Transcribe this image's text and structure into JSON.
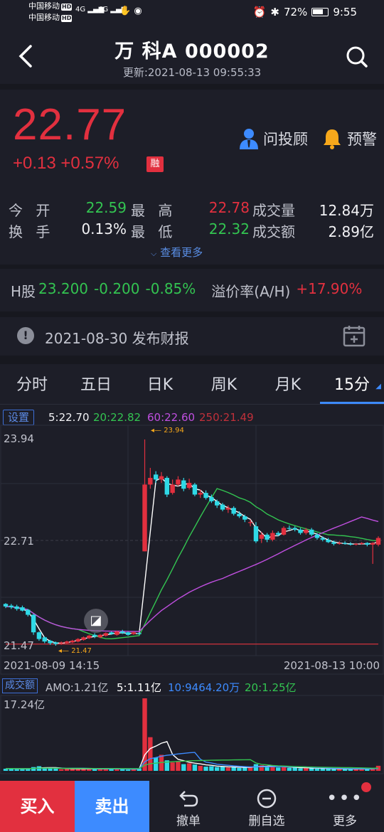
{
  "status_bar": {
    "carrier1": "中国移动",
    "carrier2": "中国移动",
    "hd": "HD",
    "signal1": "4G",
    "signal2": "4G",
    "battery": "72%",
    "time": "9:55"
  },
  "header": {
    "title": "万  科A 000002",
    "updated": "更新:2021-08-13 09:55:33"
  },
  "quote": {
    "price": "22.77",
    "change": "+0.13  +0.57%",
    "margin_badge": "融",
    "advisor_label": "问投顾",
    "alert_label": "预警"
  },
  "stats": {
    "open_label": "今 开",
    "open": "22.59",
    "high_label": "最 高",
    "high": "22.78",
    "volume_label": "成交量",
    "volume": "12.84万",
    "turnover_label": "换 手",
    "turnover": "0.13%",
    "low_label": "最 低",
    "low": "22.32",
    "amount_label": "成交额",
    "amount": "2.89亿",
    "more": "查看更多"
  },
  "h_share": {
    "label": "H股",
    "price": "23.200",
    "change": "-0.200",
    "pct": "-0.85%",
    "premium_label": "溢价率(A/H)",
    "premium": "+17.90%"
  },
  "report": {
    "text": "2021-08-30 发布财报"
  },
  "tabs": [
    "分时",
    "五日",
    "日K",
    "周K",
    "月K",
    "15分"
  ],
  "chart_legend": {
    "settings": "设置",
    "ma5": "5:22.70",
    "ma20": "20:22.82",
    "ma60": "60:22.60",
    "ma250": "250:21.49",
    "y_high": "23.94",
    "y_mid": "22.71",
    "y_low": "21.47",
    "mark_high": "23.94",
    "mark_low": "21.47",
    "date_start": "2021-08-09 14:15",
    "date_end": "2021-08-13 10:00"
  },
  "volume_legend": {
    "label": "成交额",
    "amo": "AMO:1.21亿",
    "ma5": "5:1.11亿",
    "ma10": "10:9464.20万",
    "ma20": "20:1.25亿",
    "max": "17.24亿"
  },
  "colors": {
    "up": "#e2303f",
    "down": "#2fd9e6",
    "ma5": "#ffffff",
    "ma20": "#33c451",
    "ma60": "#c04fe0",
    "ma250": "#c0303a",
    "accent": "#3d8bff"
  },
  "bottom_bar": {
    "buy": "买入",
    "sell": "卖出",
    "cancel": "撤单",
    "remove_watch": "删自选",
    "more": "更多"
  },
  "chart_data": {
    "type": "candlestick",
    "ylim": [
      21.47,
      23.94
    ],
    "candles": [
      {
        "o": 21.97,
        "c": 21.94,
        "h": 21.98,
        "l": 21.92
      },
      {
        "o": 21.95,
        "c": 21.93,
        "h": 21.97,
        "l": 21.91
      },
      {
        "o": 21.94,
        "c": 21.91,
        "h": 21.96,
        "l": 21.89
      },
      {
        "o": 21.93,
        "c": 21.89,
        "h": 21.95,
        "l": 21.88
      },
      {
        "o": 21.9,
        "c": 21.84,
        "h": 21.91,
        "l": 21.82
      },
      {
        "o": 21.84,
        "c": 21.63,
        "h": 21.85,
        "l": 21.6
      },
      {
        "o": 21.63,
        "c": 21.55,
        "h": 21.64,
        "l": 21.53
      },
      {
        "o": 21.57,
        "c": 21.52,
        "h": 21.58,
        "l": 21.5
      },
      {
        "o": 21.53,
        "c": 21.5,
        "h": 21.54,
        "l": 21.48
      },
      {
        "o": 21.51,
        "c": 21.49,
        "h": 21.52,
        "l": 21.47
      },
      {
        "o": 21.5,
        "c": 21.51,
        "h": 21.52,
        "l": 21.48
      },
      {
        "o": 21.5,
        "c": 21.52,
        "h": 21.53,
        "l": 21.49
      },
      {
        "o": 21.51,
        "c": 21.53,
        "h": 21.54,
        "l": 21.5
      },
      {
        "o": 21.52,
        "c": 21.55,
        "h": 21.56,
        "l": 21.51
      },
      {
        "o": 21.54,
        "c": 21.57,
        "h": 21.58,
        "l": 21.53
      },
      {
        "o": 21.56,
        "c": 21.59,
        "h": 21.6,
        "l": 21.55
      },
      {
        "o": 21.6,
        "c": 21.58,
        "h": 21.62,
        "l": 21.56
      },
      {
        "o": 21.57,
        "c": 21.6,
        "h": 21.61,
        "l": 21.56
      },
      {
        "o": 21.59,
        "c": 21.62,
        "h": 21.63,
        "l": 21.58
      },
      {
        "o": 21.63,
        "c": 21.61,
        "h": 21.64,
        "l": 21.6
      },
      {
        "o": 21.6,
        "c": 21.64,
        "h": 21.65,
        "l": 21.59
      },
      {
        "o": 21.64,
        "c": 21.62,
        "h": 21.66,
        "l": 21.61
      },
      {
        "o": 21.63,
        "c": 21.6,
        "h": 21.64,
        "l": 21.59
      },
      {
        "o": 21.61,
        "c": 21.63,
        "h": 21.64,
        "l": 21.6
      },
      {
        "o": 21.62,
        "c": 21.61,
        "h": 21.63,
        "l": 21.6
      },
      {
        "o": 22.6,
        "c": 23.4,
        "h": 23.94,
        "l": 22.6
      },
      {
        "o": 23.4,
        "c": 23.48,
        "h": 23.6,
        "l": 23.35
      },
      {
        "o": 23.52,
        "c": 23.46,
        "h": 23.56,
        "l": 23.42
      },
      {
        "o": 23.46,
        "c": 23.5,
        "h": 23.55,
        "l": 23.42
      },
      {
        "o": 23.48,
        "c": 23.28,
        "h": 23.5,
        "l": 23.25
      },
      {
        "o": 23.3,
        "c": 23.4,
        "h": 23.46,
        "l": 23.28
      },
      {
        "o": 23.4,
        "c": 23.46,
        "h": 23.5,
        "l": 23.38
      },
      {
        "o": 23.45,
        "c": 23.35,
        "h": 23.48,
        "l": 23.32
      },
      {
        "o": 23.36,
        "c": 23.42,
        "h": 23.47,
        "l": 23.34
      },
      {
        "o": 23.4,
        "c": 23.28,
        "h": 23.42,
        "l": 23.26
      },
      {
        "o": 23.28,
        "c": 23.3,
        "h": 23.34,
        "l": 23.24
      },
      {
        "o": 23.3,
        "c": 23.24,
        "h": 23.33,
        "l": 23.22
      },
      {
        "o": 23.25,
        "c": 23.2,
        "h": 23.28,
        "l": 23.18
      },
      {
        "o": 23.2,
        "c": 23.15,
        "h": 23.22,
        "l": 23.12
      },
      {
        "o": 23.16,
        "c": 23.1,
        "h": 23.18,
        "l": 23.08
      },
      {
        "o": 23.1,
        "c": 23.12,
        "h": 23.15,
        "l": 23.06
      },
      {
        "o": 23.12,
        "c": 23.05,
        "h": 23.14,
        "l": 23.03
      },
      {
        "o": 23.05,
        "c": 23.02,
        "h": 23.08,
        "l": 23.0
      },
      {
        "o": 23.02,
        "c": 22.98,
        "h": 23.04,
        "l": 22.95
      },
      {
        "o": 22.95,
        "c": 22.95,
        "h": 22.98,
        "l": 22.9
      },
      {
        "o": 22.9,
        "c": 22.72,
        "h": 22.95,
        "l": 22.7
      },
      {
        "o": 22.75,
        "c": 22.8,
        "h": 22.83,
        "l": 22.7
      },
      {
        "o": 22.8,
        "c": 22.74,
        "h": 22.82,
        "l": 22.71
      },
      {
        "o": 22.74,
        "c": 22.82,
        "h": 22.85,
        "l": 22.72
      },
      {
        "o": 22.82,
        "c": 22.8,
        "h": 22.84,
        "l": 22.78
      },
      {
        "o": 22.8,
        "c": 22.88,
        "h": 22.9,
        "l": 22.79
      },
      {
        "o": 22.88,
        "c": 22.87,
        "h": 22.91,
        "l": 22.85
      },
      {
        "o": 22.88,
        "c": 22.86,
        "h": 22.9,
        "l": 22.84
      },
      {
        "o": 22.86,
        "c": 22.82,
        "h": 22.88,
        "l": 22.8
      },
      {
        "o": 22.82,
        "c": 22.86,
        "h": 22.88,
        "l": 22.8
      },
      {
        "o": 22.86,
        "c": 22.8,
        "h": 22.88,
        "l": 22.78
      },
      {
        "o": 22.8,
        "c": 22.76,
        "h": 22.82,
        "l": 22.74
      },
      {
        "o": 22.76,
        "c": 22.74,
        "h": 22.78,
        "l": 22.72
      },
      {
        "o": 22.74,
        "c": 22.71,
        "h": 22.76,
        "l": 22.7
      },
      {
        "o": 22.71,
        "c": 22.69,
        "h": 22.73,
        "l": 22.67
      },
      {
        "o": 22.69,
        "c": 22.7,
        "h": 22.72,
        "l": 22.68
      },
      {
        "o": 22.7,
        "c": 22.69,
        "h": 22.72,
        "l": 22.68
      },
      {
        "o": 22.69,
        "c": 22.68,
        "h": 22.71,
        "l": 22.67
      },
      {
        "o": 22.68,
        "c": 22.69,
        "h": 22.7,
        "l": 22.67
      },
      {
        "o": 22.69,
        "c": 22.7,
        "h": 22.71,
        "l": 22.68
      },
      {
        "o": 22.7,
        "c": 22.68,
        "h": 22.71,
        "l": 22.66
      },
      {
        "o": 22.68,
        "c": 22.7,
        "h": 22.71,
        "l": 22.45
      },
      {
        "o": 22.68,
        "c": 22.76,
        "h": 22.78,
        "l": 22.66
      }
    ],
    "volumes": [
      0.5,
      0.6,
      0.4,
      0.5,
      0.5,
      0.9,
      1.1,
      0.7,
      0.6,
      0.5,
      0.4,
      0.5,
      0.5,
      0.6,
      0.4,
      0.5,
      0.4,
      0.5,
      0.6,
      0.4,
      0.5,
      0.4,
      0.3,
      0.4,
      0.6,
      17.24,
      8.0,
      3.2,
      3.8,
      2.5,
      2.0,
      2.2,
      1.6,
      1.8,
      1.5,
      1.2,
      1.0,
      1.1,
      0.9,
      1.0,
      0.8,
      0.9,
      0.7,
      0.8,
      0.9,
      1.6,
      1.3,
      0.9,
      1.1,
      0.8,
      0.9,
      0.7,
      0.8,
      0.6,
      0.7,
      0.6,
      0.5,
      0.6,
      0.5,
      0.4,
      0.5,
      0.4,
      0.5,
      0.4,
      0.5,
      0.4,
      0.7,
      1.2
    ]
  }
}
